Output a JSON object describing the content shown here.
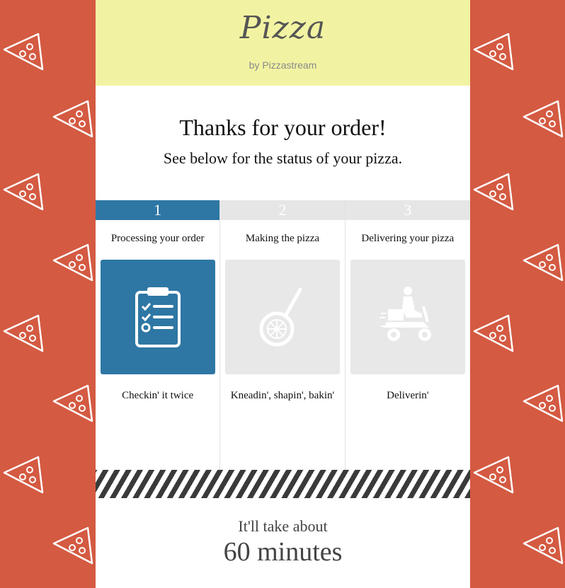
{
  "brand": {
    "name": "Pizza",
    "tagline": "by Pizzastream"
  },
  "heading": "Thanks for your order!",
  "subheading": "See below for the status of your pizza.",
  "steps": [
    {
      "number": "1",
      "title": "Processing your order",
      "caption": "Checkin' it twice",
      "icon": "clipboard-checklist-icon",
      "active": true
    },
    {
      "number": "2",
      "title": "Making the pizza",
      "caption": "Kneadin', shapin', bakin'",
      "icon": "pizza-peel-icon",
      "active": false
    },
    {
      "number": "3",
      "title": "Delivering your pizza",
      "caption": "Deliverin'",
      "icon": "delivery-scooter-icon",
      "active": false
    }
  ],
  "eta": {
    "label": "It'll take about",
    "value": "60 minutes"
  },
  "colors": {
    "background": "#d45a42",
    "header": "#f2f3a2",
    "accent": "#2e77a4",
    "inactive": "#e8e8e8"
  }
}
